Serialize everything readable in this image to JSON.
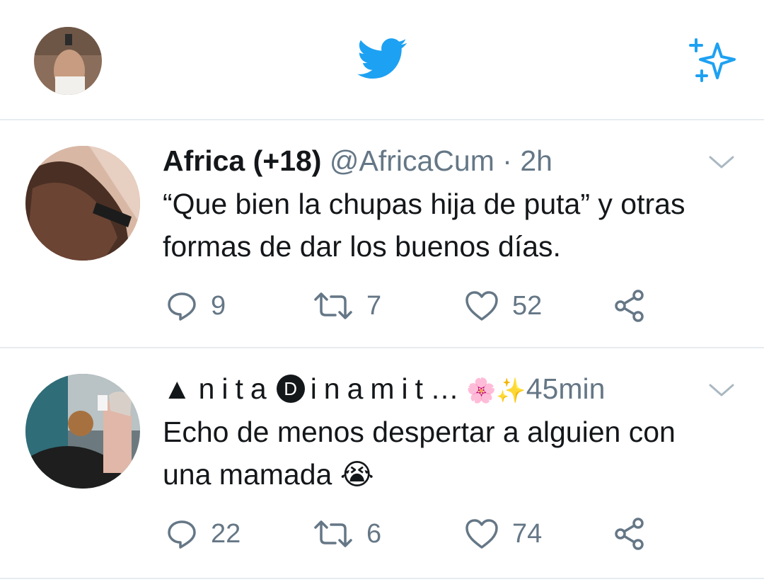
{
  "header": {
    "avatar_icon": "profile-avatar",
    "logo_icon": "twitter-bird-icon",
    "logo_color": "#1da1f2",
    "sparkle_icon": "sparkle-icon"
  },
  "tweets": [
    {
      "name": "Africa (+18)",
      "handle": "@AfricaCum",
      "dot": "·",
      "time": "2h",
      "text_line1": "“Que bien la chupas hija de puta” y otras",
      "text_line2": "formas de dar los buenos días.",
      "replies": "9",
      "retweets": "7",
      "likes": "52"
    },
    {
      "name_prefix": "▲nita",
      "name_d": "D",
      "name_suffix": "inamit…",
      "name_emoji": "🌸✨",
      "time": "45min",
      "text_line1": "Echo de menos despertar a alguien con",
      "text_line2": "una mamada",
      "text_emoji": "😭",
      "replies": "22",
      "retweets": "6",
      "likes": "74"
    }
  ],
  "colors": {
    "accent": "#1da1f2",
    "secondary_text": "#657786",
    "icon_gray": "#657786",
    "divider": "#e6ecf0"
  }
}
